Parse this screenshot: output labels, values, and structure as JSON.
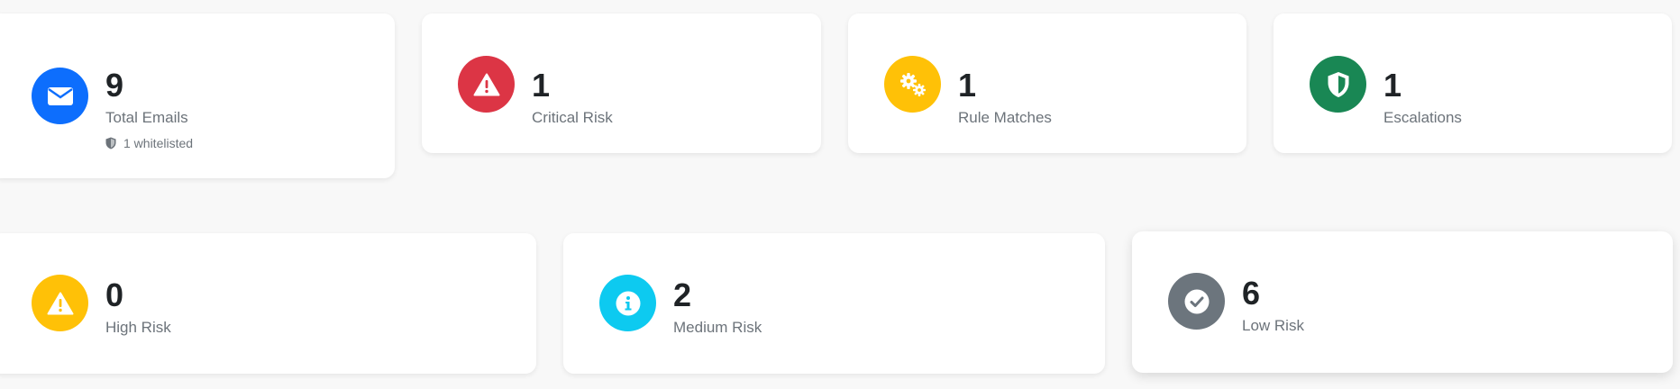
{
  "colors": {
    "blue": "#0d6efd",
    "red": "#dc3545",
    "yellow": "#ffc107",
    "green": "#198754",
    "cyan": "#0dcaf0",
    "gray": "#6c757d"
  },
  "top_row": [
    {
      "value": "9",
      "label": "Total Emails",
      "icon": "envelope-icon",
      "color": "blue",
      "sub": "1 whitelisted",
      "sub_icon": "shield-icon"
    },
    {
      "value": "1",
      "label": "Critical Risk",
      "icon": "warning-triangle-icon",
      "color": "red"
    },
    {
      "value": "1",
      "label": "Rule Matches",
      "icon": "gears-icon",
      "color": "yellow"
    },
    {
      "value": "1",
      "label": "Escalations",
      "icon": "shield-icon",
      "color": "green"
    }
  ],
  "bottom_row": [
    {
      "value": "0",
      "label": "High Risk",
      "icon": "warning-triangle-icon",
      "color": "yellow"
    },
    {
      "value": "2",
      "label": "Medium Risk",
      "icon": "info-icon",
      "color": "cyan"
    },
    {
      "value": "6",
      "label": "Low Risk",
      "icon": "check-circle-icon",
      "color": "gray"
    }
  ]
}
